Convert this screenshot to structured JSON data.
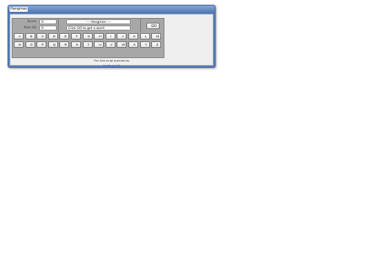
{
  "window": {
    "title": "Hangman"
  },
  "game": {
    "score_label": "Score:",
    "score_value": "0",
    "fails_label": "Fails (6):",
    "fails_value": "0",
    "header_text": "--- Hangman ---",
    "message_text": "Click GO to get a word.",
    "go_label": "GO"
  },
  "keyboard": {
    "row1": [
      "A",
      "B",
      "C",
      "D",
      "E",
      "F",
      "G",
      "H",
      "I",
      "J",
      "K",
      "L",
      "M"
    ],
    "row2": [
      "N",
      "O",
      "P",
      "Q",
      "R",
      "S",
      "T",
      "U",
      "V",
      "W",
      "X",
      "Y",
      "Z"
    ]
  },
  "footer": {
    "credit_text": "This free script provided by",
    "link_text": "JavaScript Kit"
  },
  "colors": {
    "titlebar": "#4f74ae",
    "panel": "#a7a7a7",
    "link": "#2b5fc4"
  }
}
